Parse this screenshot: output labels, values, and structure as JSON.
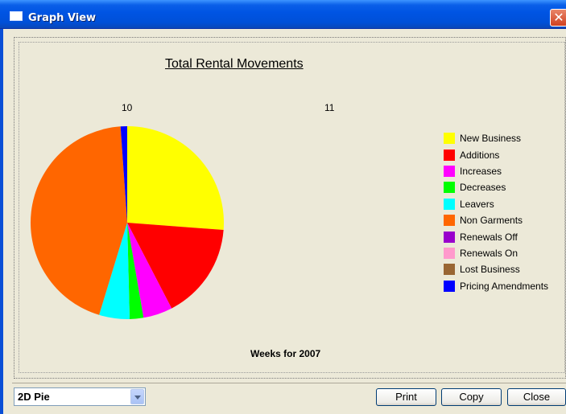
{
  "window": {
    "title": "Graph View",
    "close_glyph": "✕",
    "icon": "window-icon"
  },
  "chart": {
    "title": "Total Rental Movements",
    "top_labels": [
      "10",
      "11"
    ],
    "xlabel": "Weeks for 2007"
  },
  "chart_data": {
    "type": "pie",
    "title": "Total Rental Movements",
    "xlabel": "Weeks for 2007",
    "week_labels": [
      "10",
      "11"
    ],
    "legend_position": "right",
    "categories": [
      "New Business",
      "Additions",
      "Increases",
      "Decreases",
      "Leavers",
      "Non Garments",
      "Renewals Off",
      "Renewals On",
      "Lost Business",
      "Pricing Amendments"
    ],
    "values": [
      26.2,
      16.2,
      4.9,
      2.3,
      5.1,
      44.2,
      0,
      0,
      0,
      1.1
    ],
    "colors": [
      "#ffff00",
      "#ff0000",
      "#ff00ff",
      "#00ff00",
      "#00ffff",
      "#ff6600",
      "#9900cc",
      "#ff99cc",
      "#996633",
      "#0000ff"
    ]
  },
  "footer": {
    "chart_type_select": {
      "value": "2D Pie"
    },
    "print_label": "Print",
    "copy_label": "Copy",
    "close_label": "Close"
  }
}
